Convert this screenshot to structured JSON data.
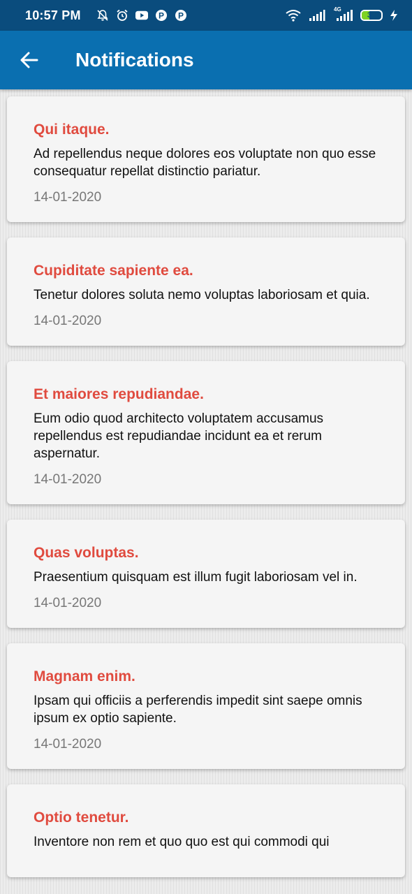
{
  "status_bar": {
    "time": "10:57 PM",
    "left_icons": [
      "mute-bell-icon",
      "alarm-icon",
      "youtube-icon",
      "p-app-icon",
      "p-app-icon"
    ],
    "right_icons": [
      "wifi-icon",
      "signal-icon",
      "signal-4g-icon"
    ],
    "network_label": "4G",
    "battery_level": "39",
    "battery_color": "#7ed321"
  },
  "app_bar": {
    "title": "Notifications",
    "back_icon": "arrow-left-icon",
    "color": "#0a6fb0"
  },
  "notifications": [
    {
      "title": "Qui itaque.",
      "body": "Ad repellendus neque dolores eos voluptate non quo esse consequatur repellat distinctio pariatur.",
      "date": "14-01-2020"
    },
    {
      "title": "Cupiditate sapiente ea.",
      "body": "Tenetur dolores soluta nemo voluptas laboriosam et quia.",
      "date": "14-01-2020"
    },
    {
      "title": "Et maiores repudiandae.",
      "body": "Eum odio quod architecto voluptatem accusamus repellendus est repudiandae incidunt ea et rerum aspernatur.",
      "date": "14-01-2020"
    },
    {
      "title": "Quas voluptas.",
      "body": "Praesentium quisquam est illum fugit laboriosam vel in.",
      "date": "14-01-2020"
    },
    {
      "title": "Magnam enim.",
      "body": "Ipsam qui officiis a perferendis impedit sint saepe omnis ipsum ex optio sapiente.",
      "date": "14-01-2020"
    },
    {
      "title": "Optio tenetur.",
      "body": "Inventore non rem et quo quo est qui commodi qui",
      "date": ""
    }
  ],
  "colors": {
    "title_red": "#e04b3f",
    "status_bar_bg": "#0a4c7d"
  }
}
